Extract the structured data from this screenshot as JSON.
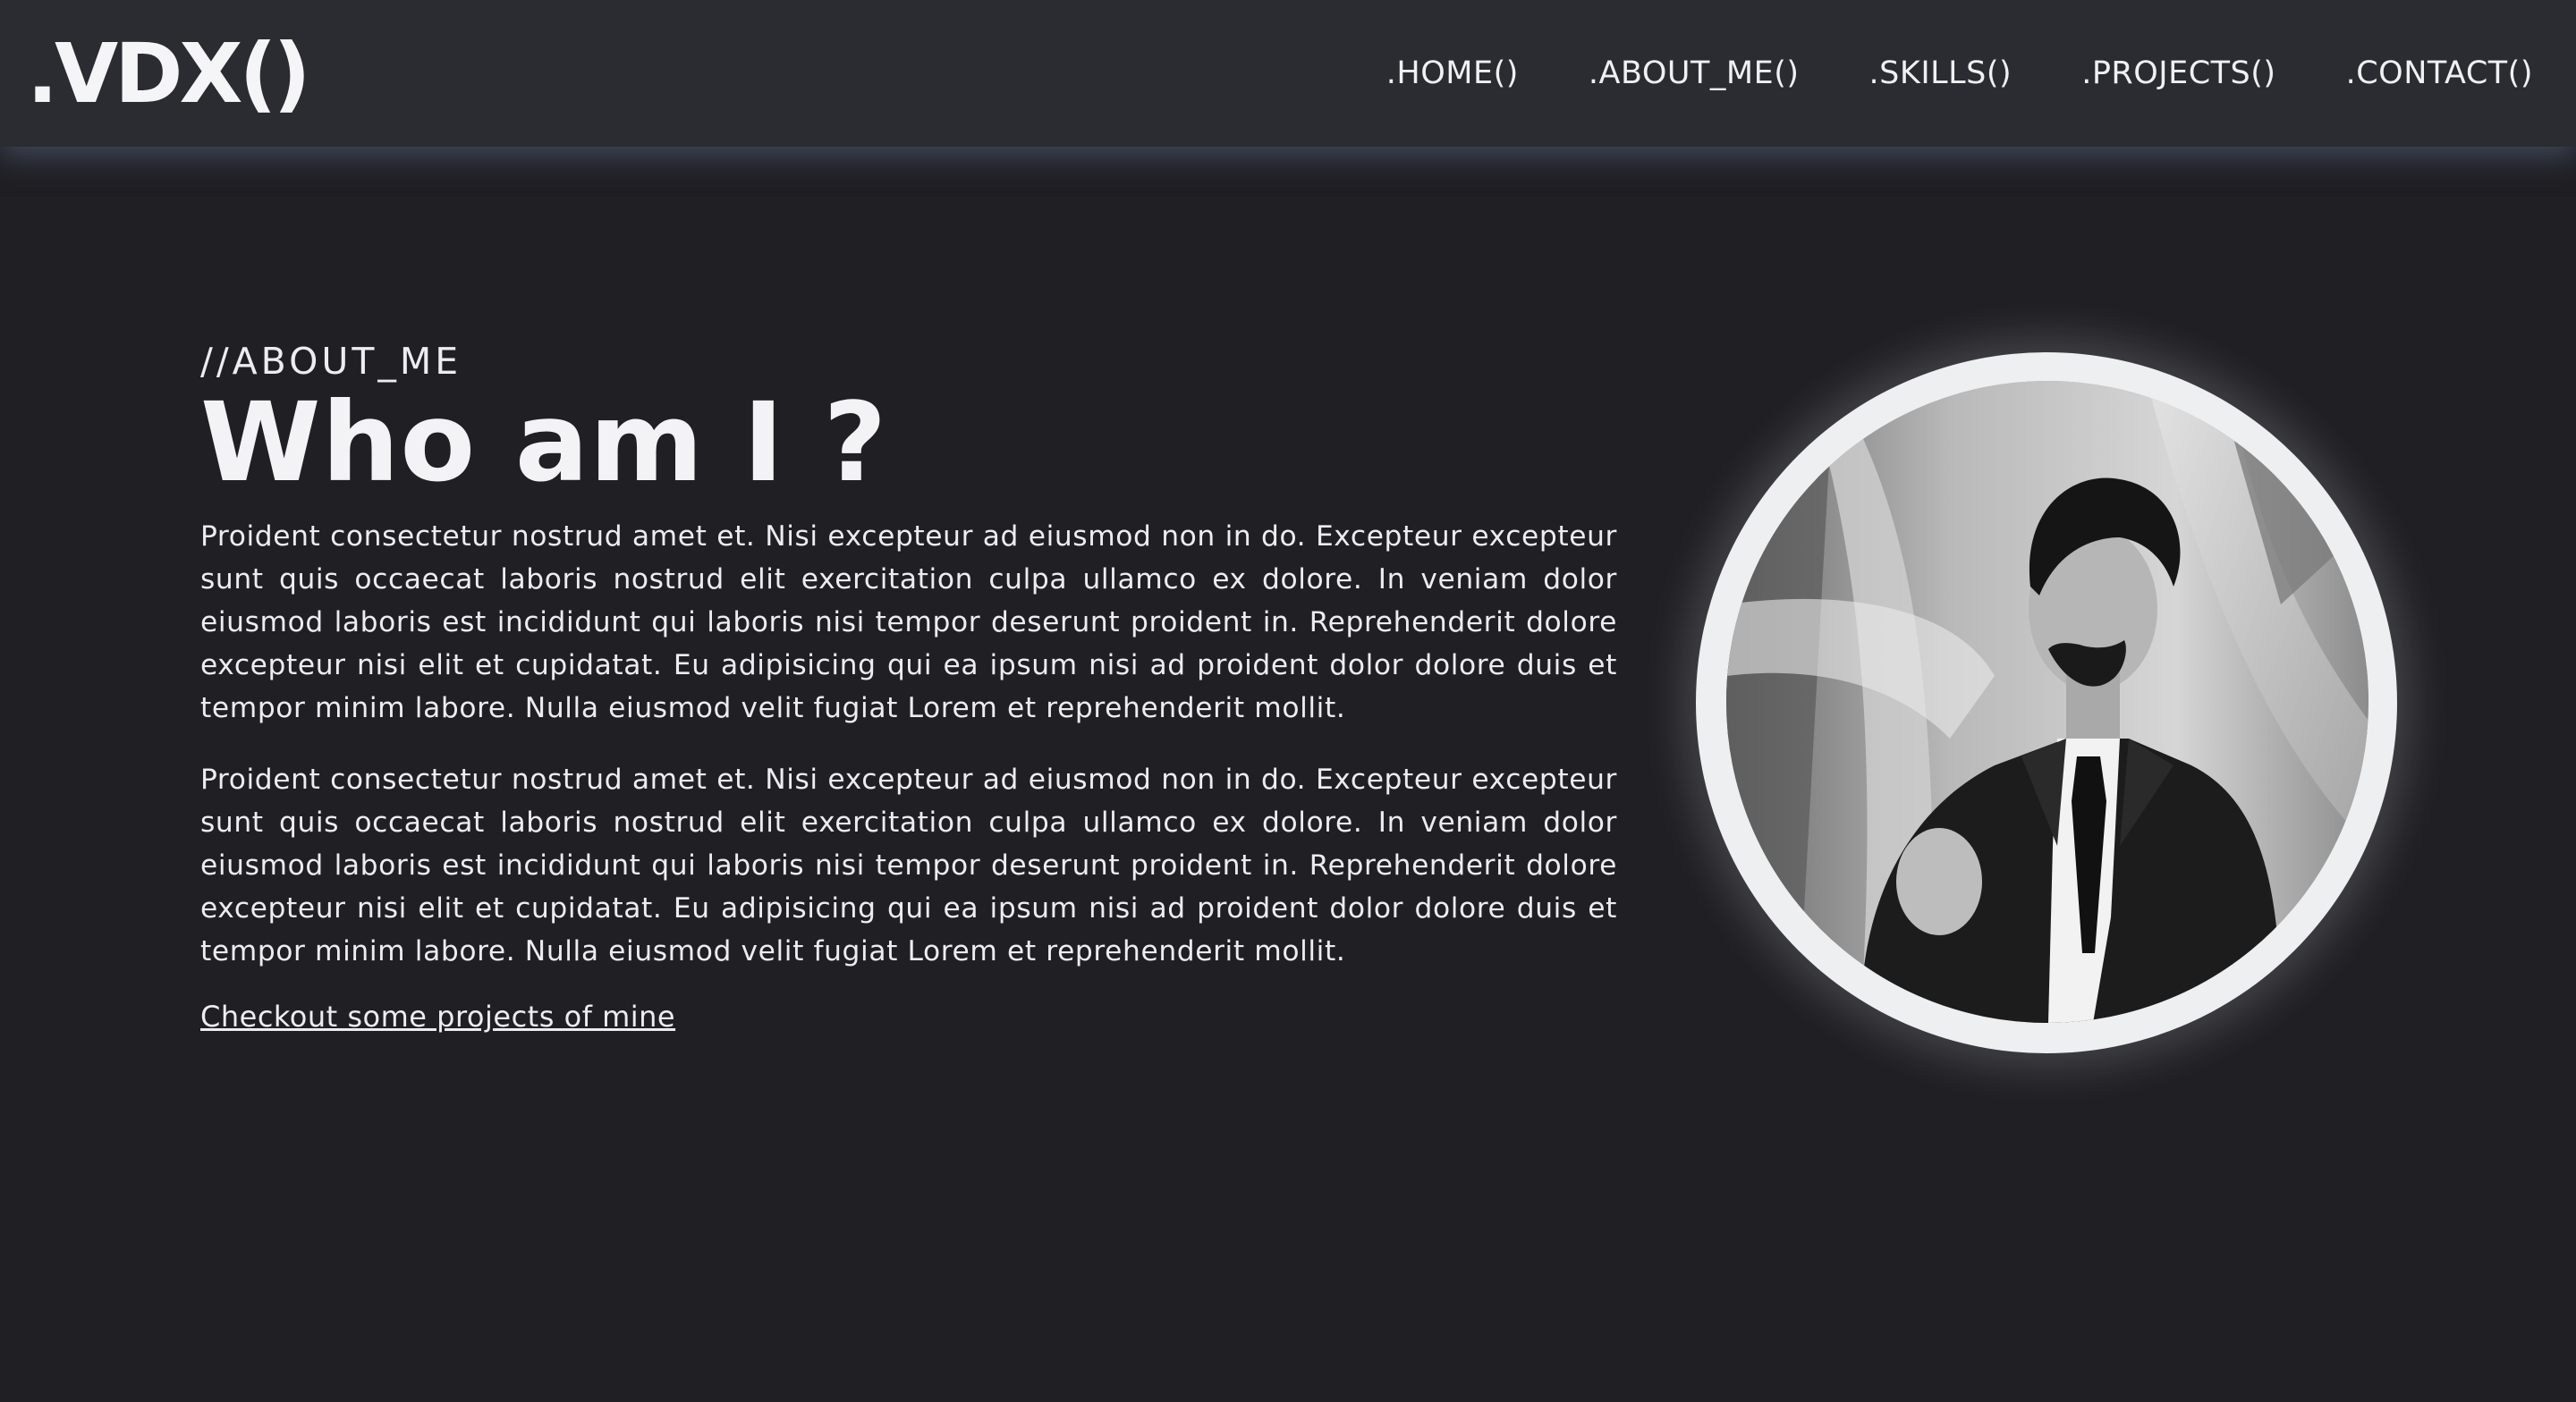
{
  "header": {
    "logo": ".VDX()",
    "nav": [
      {
        "label": ".HOME()"
      },
      {
        "label": ".ABOUT_ME()"
      },
      {
        "label": ".SKILLS()"
      },
      {
        "label": ".PROJECTS()"
      },
      {
        "label": ".CONTACT()"
      }
    ]
  },
  "about": {
    "eyebrow": "//ABOUT_ME",
    "title": "Who am I ?",
    "paragraphs": [
      "Proident consectetur nostrud amet et. Nisi excepteur ad eiusmod non in do. Excepteur excepteur sunt quis occaecat laboris nostrud elit exercitation culpa ullamco ex dolore. In veniam dolor eiusmod laboris est incididunt qui laboris nisi tempor deserunt proident in. Reprehenderit dolore excepteur nisi elit et cupidatat. Eu adipisicing qui ea ipsum nisi ad proident dolor dolore duis et tempor minim labore. Nulla eiusmod velit fugiat Lorem et reprehenderit mollit.",
      "Proident consectetur nostrud amet et. Nisi excepteur ad eiusmod non in do. Excepteur excepteur sunt quis occaecat laboris nostrud elit exercitation culpa ullamco ex dolore. In veniam dolor eiusmod laboris est incididunt qui laboris nisi tempor deserunt proident in. Reprehenderit dolore excepteur nisi elit et cupidatat. Eu adipisicing qui ea ipsum nisi ad proident dolor dolore duis et tempor minim labore. Nulla eiusmod velit fugiat Lorem et reprehenderit mollit."
    ],
    "cta": "Checkout some projects of mine"
  },
  "profile_photo": {
    "icon": "profile-photo-grayscale"
  },
  "colors": {
    "background": "#1f1f24",
    "navbar": "#2a2c31",
    "text": "#ededf0",
    "ring": "#eeeff1"
  }
}
